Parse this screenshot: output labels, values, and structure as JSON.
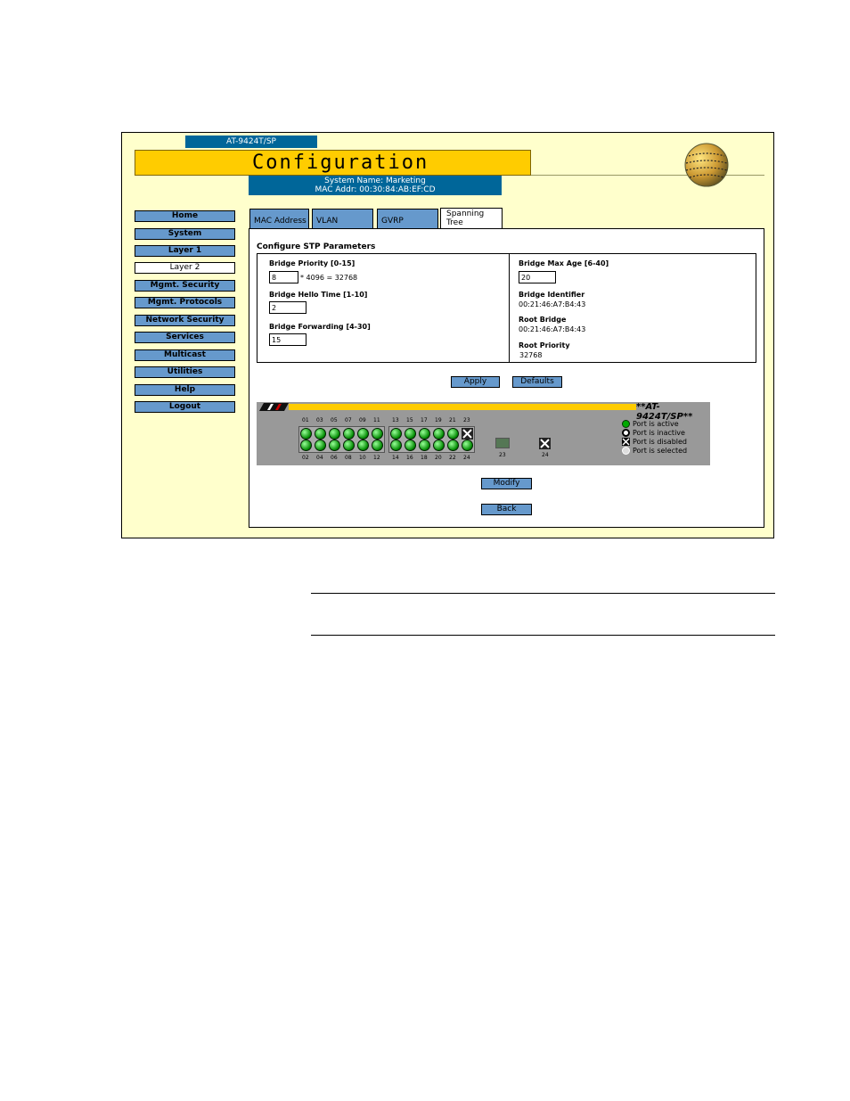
{
  "header": {
    "model": "AT-9424T/SP",
    "title": "Configuration",
    "system_name": "System Name: Marketing",
    "mac_addr": "MAC Addr: 00:30:84:AB:EF:CD"
  },
  "nav": {
    "items": [
      "Home",
      "System",
      "Layer 1",
      "Layer 2",
      "Mgmt. Security",
      "Mgmt. Protocols",
      "Network Security",
      "Services",
      "Multicast",
      "Utilities",
      "Help",
      "Logout"
    ],
    "active": "Layer 2"
  },
  "tabs": {
    "mac": "MAC Address",
    "vlan": "VLAN",
    "gvrp": "GVRP",
    "stp1": "Spanning",
    "stp2": "Tree"
  },
  "stp": {
    "title": "Configure STP Parameters",
    "bridge_priority_label": "Bridge Priority [0-15]",
    "bridge_priority_value": "8",
    "bridge_priority_calc": "* 4096 = 32768",
    "hello_label": "Bridge Hello Time [1-10]",
    "hello_value": "2",
    "forward_label": "Bridge Forwarding [4-30]",
    "forward_value": "15",
    "max_age_label": "Bridge Max Age [6-40]",
    "max_age_value": "20",
    "identifier_label": "Bridge Identifier",
    "identifier_value": "00:21:46:A7:B4:43",
    "root_bridge_label": "Root Bridge",
    "root_bridge_value": "00:21:46:A7:B4:43",
    "root_priority_label": "Root Priority",
    "root_priority_value": "32768"
  },
  "buttons": {
    "apply": "Apply",
    "defaults": "Defaults",
    "modify": "Modify",
    "back": "Back"
  },
  "switch": {
    "model": "**AT-9424T/SP**",
    "top_ports": [
      "01",
      "03",
      "05",
      "07",
      "09",
      "11",
      "13",
      "15",
      "17",
      "19",
      "21",
      "23"
    ],
    "bottom_ports": [
      "02",
      "04",
      "06",
      "08",
      "10",
      "12",
      "14",
      "16",
      "18",
      "20",
      "22",
      "24"
    ],
    "sfp_23": "23",
    "sfp_24": "24",
    "legend": {
      "active": "Port is active",
      "inactive": "Port is inactive",
      "disabled": "Port is disabled",
      "selected": "Port is selected"
    },
    "colors": {
      "active": "#00aa00",
      "bar": "#ffcc00",
      "chassis": "#999999"
    }
  }
}
